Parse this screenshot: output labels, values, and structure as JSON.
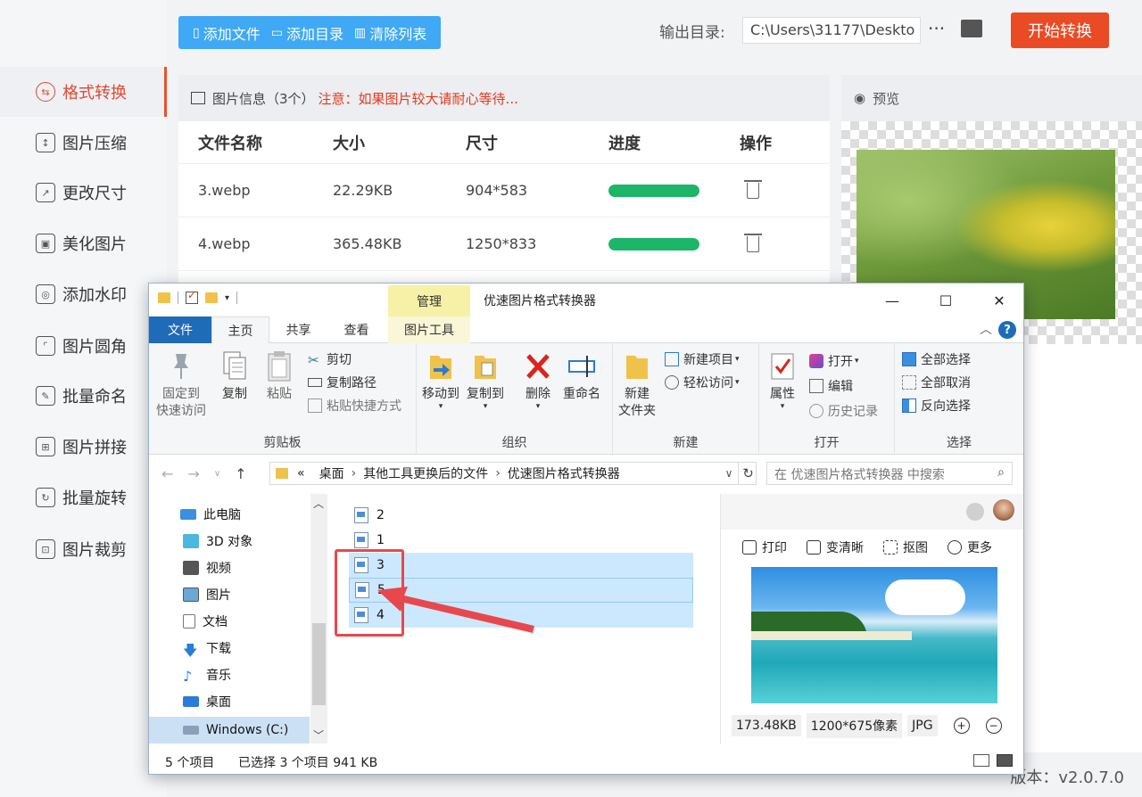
{
  "sidebar": {
    "items": [
      {
        "label": "格式转换",
        "active": true
      },
      {
        "label": "图片压缩"
      },
      {
        "label": "更改尺寸"
      },
      {
        "label": "美化图片"
      },
      {
        "label": "添加水印"
      },
      {
        "label": "图片圆角"
      },
      {
        "label": "批量命名"
      },
      {
        "label": "图片拼接"
      },
      {
        "label": "批量旋转"
      },
      {
        "label": "图片裁剪"
      }
    ]
  },
  "toolbar": {
    "add_file": "添加文件",
    "add_dir": "添加目录",
    "clear_list": "清除列表",
    "output_label": "输出目录:",
    "output_path": "C:\\Users\\31177\\Deskto",
    "more": "···",
    "start": "开始转换"
  },
  "file_panel": {
    "title": "图片信息（3个）",
    "warning": "注意：如果图片较大请耐心等待...",
    "columns": [
      "文件名称",
      "大小",
      "尺寸",
      "进度",
      "操作"
    ],
    "rows": [
      {
        "name": "3.webp",
        "size": "22.29KB",
        "dims": "904*583",
        "progress": 1.0
      },
      {
        "name": "4.webp",
        "size": "365.48KB",
        "dims": "1250*833",
        "progress": 1.0
      }
    ]
  },
  "preview_panel": {
    "title": "预览"
  },
  "footer": {
    "version": "版本：v2.0.7.0"
  },
  "explorer": {
    "title": "优速图片格式转换器",
    "manage_tab": "管理",
    "tabs": {
      "file": "文件",
      "home": "主页",
      "share": "共享",
      "view": "查看",
      "tools": "图片工具"
    },
    "clipboard": {
      "pin_1": "固定到",
      "pin_2": "快速访问",
      "copy": "复制",
      "paste": "粘贴",
      "cut": "剪切",
      "copy_path": "复制路径",
      "paste_shortcut": "粘贴快捷方式",
      "label": "剪贴板"
    },
    "organize": {
      "move": "移动到",
      "copyto": "复制到",
      "delete": "删除",
      "rename": "重命名",
      "label": "组织"
    },
    "new": {
      "folder_1": "新建",
      "folder_2": "文件夹",
      "new_item": "新建项目",
      "easy_access": "轻松访问",
      "label": "新建"
    },
    "open": {
      "props": "属性",
      "open": "打开",
      "edit": "编辑",
      "history": "历史记录",
      "label": "打开"
    },
    "select": {
      "all": "全部选择",
      "none": "全部取消",
      "invert": "反向选择",
      "label": "选择"
    },
    "address": {
      "prefix": "«",
      "crumbs": [
        "桌面",
        "其他工具更换后的文件",
        "优速图片格式转换器"
      ]
    },
    "search_placeholder": "在 优速图片格式转换器 中搜索",
    "nav": [
      "此电脑",
      "3D 对象",
      "视频",
      "图片",
      "文档",
      "下载",
      "音乐",
      "桌面",
      "Windows (C:)"
    ],
    "files": [
      "2",
      "1",
      "3",
      "5",
      "4"
    ],
    "preview": {
      "print": "打印",
      "enhance": "变清晰",
      "cutout": "抠图",
      "more": "更多",
      "size": "173.48KB",
      "dims": "1200*675像素",
      "format": "JPG"
    },
    "status": {
      "count": "5 个项目",
      "selected": "已选择 3 个项目  941 KB"
    }
  }
}
